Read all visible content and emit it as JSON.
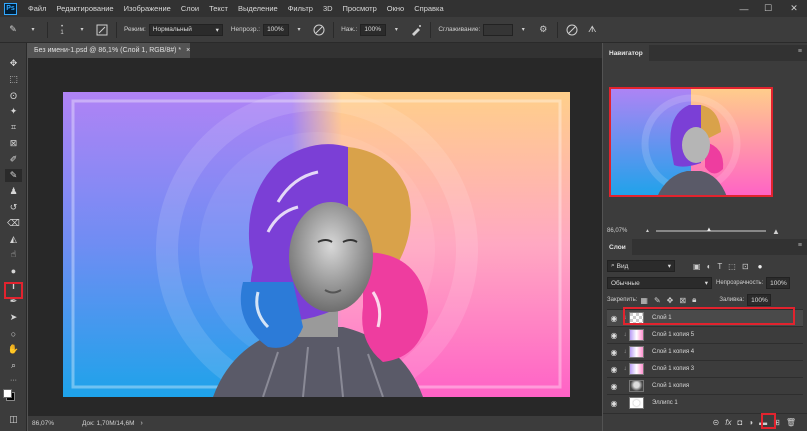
{
  "app": {
    "logo": "Ps"
  },
  "menu": [
    "Файл",
    "Редактирование",
    "Изображение",
    "Слои",
    "Текст",
    "Выделение",
    "Фильтр",
    "3D",
    "Просмотр",
    "Окно",
    "Справка"
  ],
  "window_controls": {
    "minimize": "—",
    "maximize": "☐",
    "close": "✕"
  },
  "options": {
    "brush_size": "1",
    "mode_label": "Режим:",
    "mode_value": "Нормальный",
    "opacity_label": "Непрозр.:",
    "opacity_value": "100%",
    "pressure_label": "Наж.:",
    "pressure_value": "100%",
    "smoothing_label": "Сглаживание:"
  },
  "document": {
    "tab_title": "Без имени-1.psd @ 86,1% (Слой 1, RGB/8#) *",
    "tab_close": "×",
    "zoom": "86,07%",
    "doc_info": "Док: 1,70M/14,6M"
  },
  "navigator": {
    "title": "Навигатор",
    "zoom": "86,07%",
    "zoom_out": "▲",
    "zoom_in": "▲"
  },
  "layers_panel": {
    "title": "Слои",
    "filter_kind": "Вид",
    "blend_mode": "Обычные",
    "opacity_label": "Непрозрачность:",
    "opacity_value": "100%",
    "lock_label": "Закрепить:",
    "fill_label": "Заливка:",
    "fill_value": "100%",
    "layers": [
      {
        "name": "Слой 1",
        "selected": true
      },
      {
        "name": "Слой 1 копия 5",
        "selected": false
      },
      {
        "name": "Слой 1 копия 4",
        "selected": false
      },
      {
        "name": "Слой 1 копия 3",
        "selected": false
      },
      {
        "name": "Слой 1 копия",
        "selected": false
      },
      {
        "name": "Эллипс 1",
        "selected": false
      }
    ],
    "footer_fx": "fx"
  },
  "colors": {
    "highlight": "#e2232e",
    "accent_blue": "#31a8ff"
  }
}
